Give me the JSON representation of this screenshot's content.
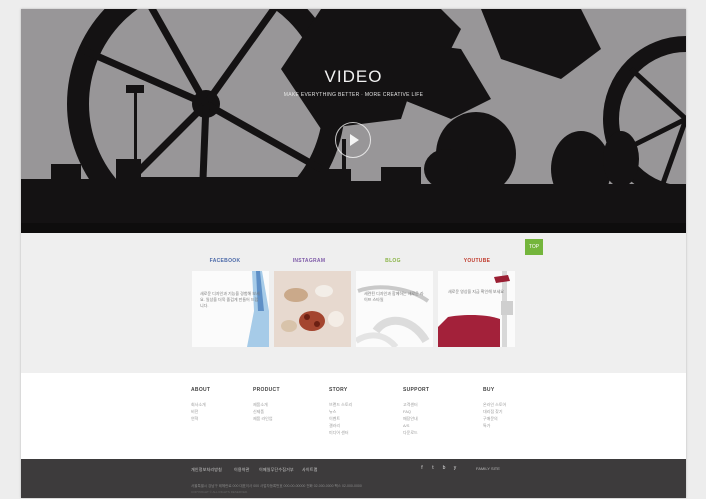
{
  "hero": {
    "title": "VIDEO",
    "subtitle": "MAKE EVERYTHING BETTER · MORE CREATIVE LIFE"
  },
  "social": {
    "tabs": [
      {
        "label": "FACEBOOK",
        "color": "#4a68a8"
      },
      {
        "label": "INSTAGRAM",
        "color": "#7e5aa8"
      },
      {
        "label": "BLOG",
        "color": "#8ab446"
      },
      {
        "label": "YOUTUBE",
        "color": "#c0392b"
      }
    ],
    "cards": [
      {
        "text": "새로운 디자인과 기능을 경험해 보세요. 일상을 더욱 즐겁게 만들어 드립니다."
      },
      {
        "text": ""
      },
      {
        "text": "세련된 디자인과 함께하는 새로운 라이프 스타일"
      },
      {
        "text": "새로운 영상을 지금 확인해 보세요"
      }
    ],
    "top_label": "TOP"
  },
  "menu": {
    "columns": [
      {
        "heading": "ABOUT",
        "items": [
          "회사소개",
          "비전",
          "연혁"
        ]
      },
      {
        "heading": "PRODUCT",
        "items": [
          "제품소개",
          "신제품",
          "제품 라인업"
        ]
      },
      {
        "heading": "STORY",
        "items": [
          "브랜드 스토리",
          "뉴스",
          "이벤트",
          "갤러리",
          "미디어 센터"
        ]
      },
      {
        "heading": "SUPPORT",
        "items": [
          "고객센터",
          "FAQ",
          "매장안내",
          "A/S",
          "다운로드"
        ]
      },
      {
        "heading": "BUY",
        "items": [
          "온라인 스토어",
          "대리점 찾기",
          "구매문의",
          "특가"
        ]
      }
    ]
  },
  "footer": {
    "nav": [
      "개인정보처리방침",
      "이용약관",
      "이메일무단수집거부",
      "사이트맵"
    ],
    "social_icons": [
      "f",
      "t",
      "b",
      "y"
    ],
    "family_site": "FAMILY SITE",
    "copyright": "서울특별시 강남구 테헤란로 000  대표이사 000  사업자등록번호 000-00-00000  전화 02-000-0000  팩스 02-000-0000",
    "copyright2": "COPYRIGHT © ALL RIGHTS RESERVED."
  }
}
